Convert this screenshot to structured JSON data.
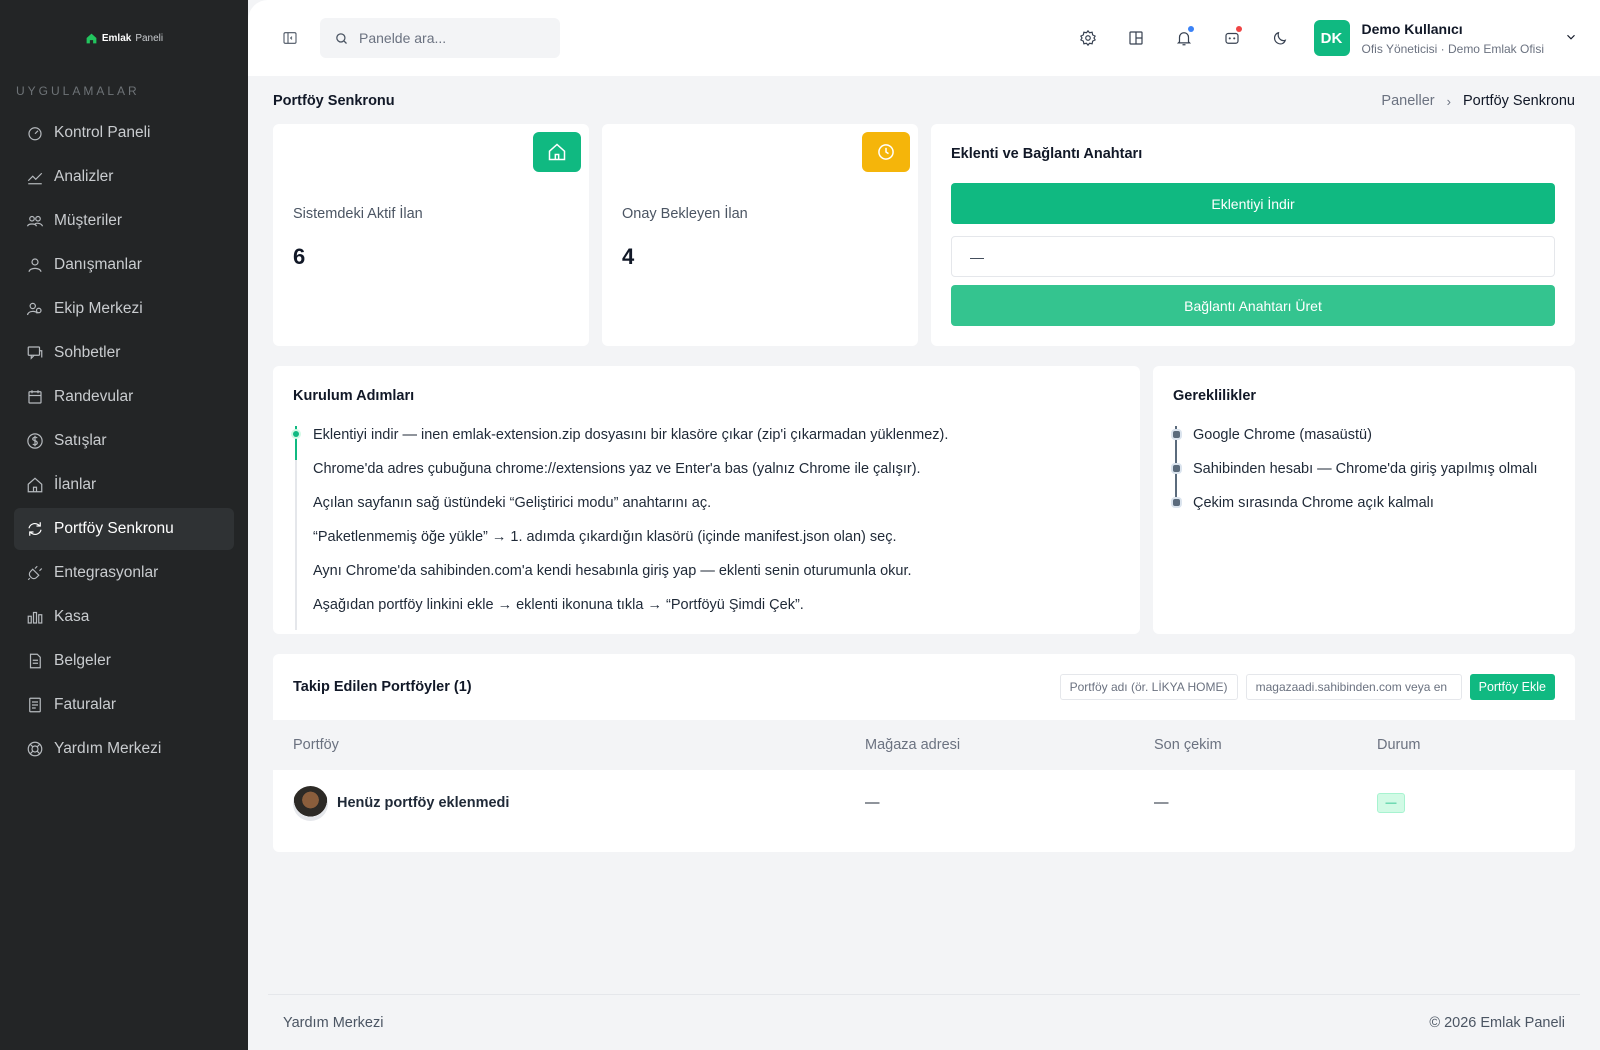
{
  "brand": {
    "name": "Emlak",
    "suffix": "Paneli"
  },
  "sidebar": {
    "section_title": "UYGULAMALAR",
    "items": [
      {
        "label": "Kontrol Paneli",
        "icon": "dashboard-icon",
        "active": false
      },
      {
        "label": "Analizler",
        "icon": "chart-line-icon",
        "active": false
      },
      {
        "label": "Müşteriler",
        "icon": "users-icon",
        "active": false
      },
      {
        "label": "Danışmanlar",
        "icon": "user-icon",
        "active": false
      },
      {
        "label": "Ekip Merkezi",
        "icon": "team-icon",
        "active": false
      },
      {
        "label": "Sohbetler",
        "icon": "chat-icon",
        "active": false
      },
      {
        "label": "Randevular",
        "icon": "calendar-icon",
        "active": false
      },
      {
        "label": "Satışlar",
        "icon": "dollar-icon",
        "active": false
      },
      {
        "label": "İlanlar",
        "icon": "home-icon",
        "active": false
      },
      {
        "label": "Portföy Senkronu",
        "icon": "sync-icon",
        "active": true
      },
      {
        "label": "Entegrasyonlar",
        "icon": "plug-icon",
        "active": false
      },
      {
        "label": "Kasa",
        "icon": "bar-chart-icon",
        "active": false
      },
      {
        "label": "Belgeler",
        "icon": "document-icon",
        "active": false
      },
      {
        "label": "Faturalar",
        "icon": "invoice-icon",
        "active": false
      },
      {
        "label": "Yardım Merkezi",
        "icon": "lifebuoy-icon",
        "active": false
      }
    ]
  },
  "topbar": {
    "search_placeholder": "Panelde ara...",
    "user": {
      "initials": "DK",
      "name": "Demo Kullanıcı",
      "role": "Ofis Yöneticisi · Demo Emlak Ofisi"
    },
    "notification_dot_color": "#3b82f6",
    "message_dot_color": "#ef4444"
  },
  "page": {
    "title": "Portföy Senkronu",
    "breadcrumb": [
      "Paneller",
      "Portföy Senkronu"
    ]
  },
  "stats": [
    {
      "label": "Sistemdeki Aktif İlan",
      "value": "6",
      "icon": "home-icon",
      "color": "#10b981"
    },
    {
      "label": "Onay Bekleyen İlan",
      "value": "4",
      "icon": "clock-icon",
      "color": "#f5b50a"
    }
  ],
  "extension": {
    "title": "Eklenti ve Bağlantı Anahtarı",
    "download_label": "Eklentiyi İndir",
    "key_value": "—",
    "generate_label": "Bağlantı Anahtarı Üret",
    "download_color": "#10b981",
    "generate_color": "#34c48f"
  },
  "setup": {
    "title": "Kurulum Adımları",
    "steps": [
      "Eklentiyi indir — inen emlak-extension.zip dosyasını bir klasöre çıkar (zip'i çıkarmadan yüklenmez).",
      "Chrome'da adres çubuğuna chrome://extensions yaz ve Enter'a bas (yalnız Chrome ile çalışır).",
      "Açılan sayfanın sağ üstündeki “Geliştirici modu” anahtarını aç.",
      "“Paketlenmemiş öğe yükle” → 1. adımda çıkardığın klasörü (içinde manifest.json olan) seç.",
      "Aynı Chrome'da sahibinden.com'a kendi hesabınla giriş yap — eklenti senin oturumunla okur.",
      "Aşağıdan portföy linkini ekle → eklenti ikonuna tıkla → “Portföyü Şimdi Çek”."
    ]
  },
  "requirements": {
    "title": "Gereklilikler",
    "items": [
      "Google Chrome (masaüstü)",
      "Sahibinden hesabı — Chrome'da giriş yapılmış olmalı",
      "Çekim sırasında Chrome açık kalmalı"
    ]
  },
  "portfolios": {
    "title": "Takip Edilen Portföyler (1)",
    "name_placeholder": "Portföy adı (ör. LİKYA HOME)",
    "url_placeholder": "magazaadi.sahibinden.com veya en",
    "add_label": "Portföy Ekle",
    "columns": [
      "Portföy",
      "Mağaza adresi",
      "Son çekim",
      "Durum"
    ],
    "rows": [
      {
        "name": "Henüz portföy eklenmedi",
        "store": "—",
        "last": "—",
        "status": "—"
      }
    ]
  },
  "footer": {
    "left": "Yardım Merkezi",
    "right": "© 2026 Emlak Paneli"
  }
}
